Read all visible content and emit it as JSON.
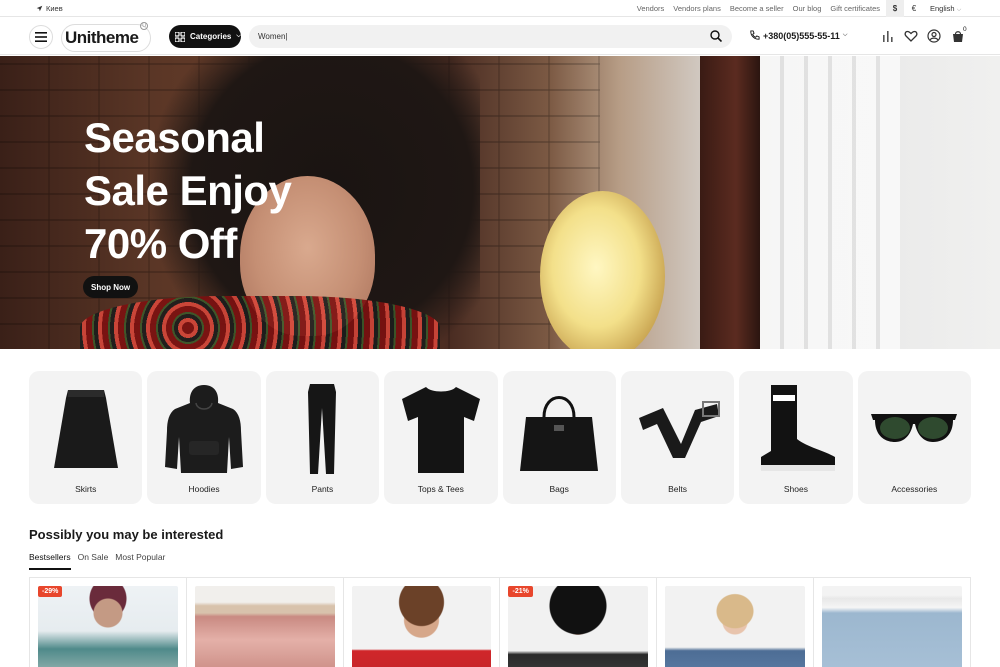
{
  "topbar": {
    "location": "Киев",
    "links": [
      "Vendors",
      "Vendors plans",
      "Become a seller",
      "Our blog",
      "Gift certificates"
    ],
    "currency_usd": "$",
    "currency_eur": "€",
    "language": "English"
  },
  "header": {
    "logo_bold": "Uni",
    "logo_rest": "theme",
    "categories_label": "Categories",
    "search_value": "Women|",
    "phone": "+380(05)555-55-11",
    "cart_count": "0"
  },
  "hero": {
    "headline_line1": "Seasonal",
    "headline_line2": "Sale Enjoy",
    "headline_line3": "70% Off",
    "cta": "Shop Now"
  },
  "categories": [
    {
      "label": "Skirts",
      "icon": "skirt-icon"
    },
    {
      "label": "Hoodies",
      "icon": "hoodie-icon"
    },
    {
      "label": "Pants",
      "icon": "pants-icon"
    },
    {
      "label": "Tops & Tees",
      "icon": "tshirt-icon"
    },
    {
      "label": "Bags",
      "icon": "bag-icon"
    },
    {
      "label": "Belts",
      "icon": "belt-icon"
    },
    {
      "label": "Shoes",
      "icon": "shoe-icon"
    },
    {
      "label": "Accessories",
      "icon": "sunglasses-icon"
    }
  ],
  "section": {
    "title": "Possibly you may be interested",
    "tabs": [
      "Bestsellers",
      "On Sale",
      "Most Popular"
    ]
  },
  "products": [
    {
      "badge": "-29%"
    },
    {
      "badge": ""
    },
    {
      "badge": ""
    },
    {
      "badge": "-21%"
    },
    {
      "badge": ""
    },
    {
      "badge": ""
    }
  ],
  "colors": {
    "accent": "#111111",
    "sale_badge": "#e8462c",
    "card_bg": "#f3f3f3"
  }
}
